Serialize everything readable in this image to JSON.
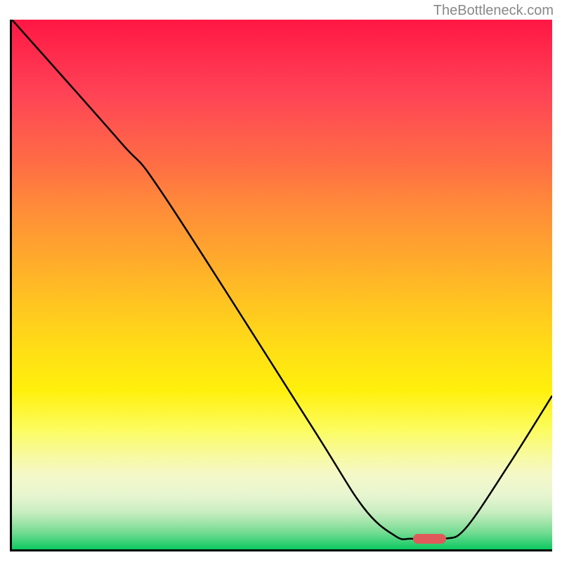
{
  "watermark": "TheBottleneck.com",
  "chart_data": {
    "type": "line",
    "title": "",
    "xlabel": "",
    "ylabel": "",
    "xlim": [
      0,
      100
    ],
    "ylim": [
      0,
      100
    ],
    "curve_points": [
      {
        "x": 0,
        "y": 100
      },
      {
        "x": 20,
        "y": 77
      },
      {
        "x": 28,
        "y": 67
      },
      {
        "x": 55,
        "y": 24
      },
      {
        "x": 65,
        "y": 8
      },
      {
        "x": 71,
        "y": 2.5
      },
      {
        "x": 74,
        "y": 2
      },
      {
        "x": 80,
        "y": 2
      },
      {
        "x": 84,
        "y": 4
      },
      {
        "x": 92,
        "y": 16
      },
      {
        "x": 100,
        "y": 29
      }
    ],
    "marker": {
      "x_start": 74,
      "x_end": 80,
      "y": 2,
      "color": "#e05a5a"
    },
    "gradient_colors": {
      "top": "#ff1744",
      "middle": "#ffcc1e",
      "bottom": "#0cc960"
    }
  }
}
